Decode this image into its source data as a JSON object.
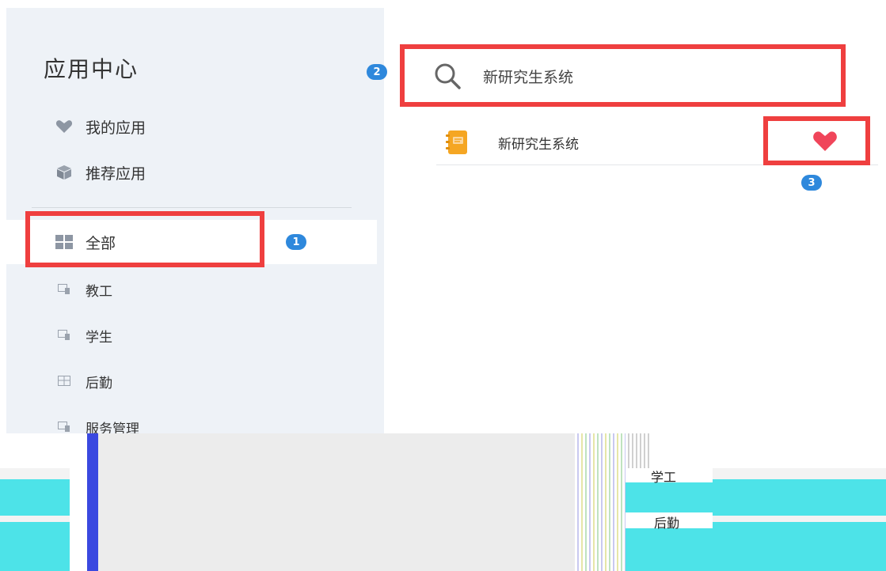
{
  "sidebar": {
    "title": "应用中心",
    "items": [
      {
        "label": "我的应用",
        "icon": "heart-icon"
      },
      {
        "label": "推荐应用",
        "icon": "cube-icon"
      }
    ],
    "categories": [
      {
        "label": "全部",
        "icon": "grid-icon",
        "active": true
      },
      {
        "label": "教工",
        "icon": "app-icon"
      },
      {
        "label": "学生",
        "icon": "app-icon"
      },
      {
        "label": "后勤",
        "icon": "app-icon"
      },
      {
        "label": "服务管理",
        "icon": "app-icon"
      }
    ]
  },
  "search": {
    "value": "新研究生系统"
  },
  "results": [
    {
      "name": "新研究生系统",
      "icon": "notebook-icon",
      "favorited": true
    }
  ],
  "annotations": {
    "badge1": "1",
    "badge2": "2",
    "badge3": "3"
  },
  "glitch_text": {
    "row1": "学工",
    "row2": "后勤"
  },
  "colors": {
    "highlight": "#ef3f3f",
    "badge": "#2e88dc",
    "heart": "#f0455a",
    "sidebar_bg": "#eef2f7"
  }
}
